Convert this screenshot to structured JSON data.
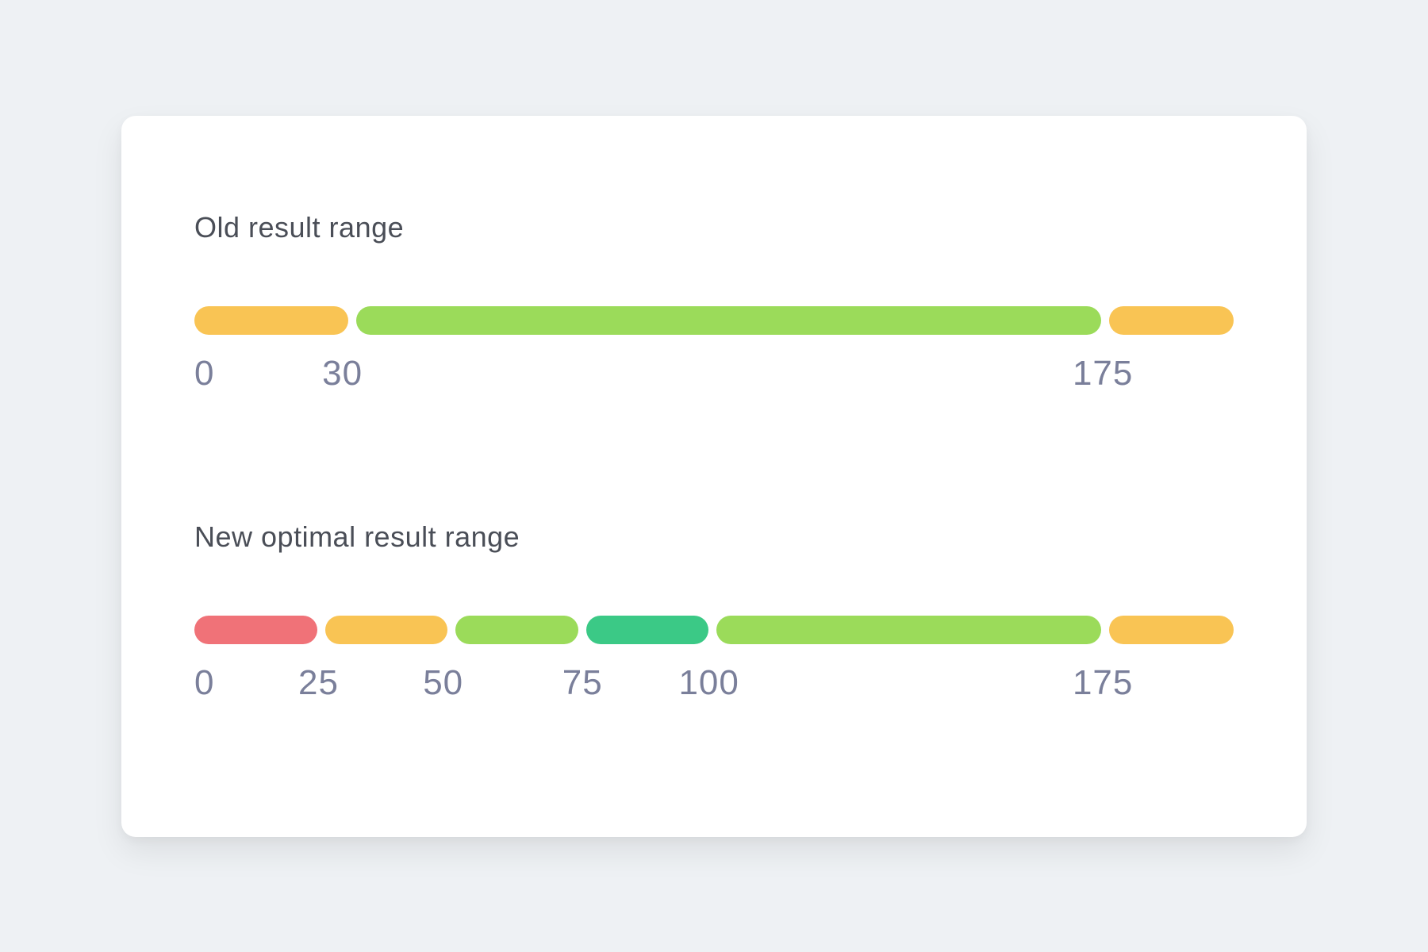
{
  "colors": {
    "red": "#f07278",
    "orange": "#f9c454",
    "light_green": "#9bdb5a",
    "green": "#3bc986"
  },
  "old": {
    "title": "Old result range",
    "ticks": [
      "0",
      "30",
      "175"
    ]
  },
  "new": {
    "title": "New optimal result range",
    "ticks": [
      "0",
      "25",
      "50",
      "75",
      "100",
      "175"
    ]
  },
  "chart_data": [
    {
      "type": "bar",
      "title": "Old result range",
      "x_range": [
        0,
        200
      ],
      "segments": [
        {
          "start": 0,
          "end": 30,
          "status": "warning"
        },
        {
          "start": 30,
          "end": 175,
          "status": "normal"
        },
        {
          "start": 175,
          "end": 200,
          "status": "warning"
        }
      ],
      "ticks": [
        0,
        30,
        175
      ]
    },
    {
      "type": "bar",
      "title": "New optimal result range",
      "x_range": [
        0,
        200
      ],
      "segments": [
        {
          "start": 0,
          "end": 25,
          "status": "critical"
        },
        {
          "start": 25,
          "end": 50,
          "status": "warning"
        },
        {
          "start": 50,
          "end": 75,
          "status": "normal"
        },
        {
          "start": 75,
          "end": 100,
          "status": "optimal"
        },
        {
          "start": 100,
          "end": 175,
          "status": "normal"
        },
        {
          "start": 175,
          "end": 200,
          "status": "warning"
        }
      ],
      "ticks": [
        0,
        25,
        50,
        75,
        100,
        175
      ]
    }
  ]
}
